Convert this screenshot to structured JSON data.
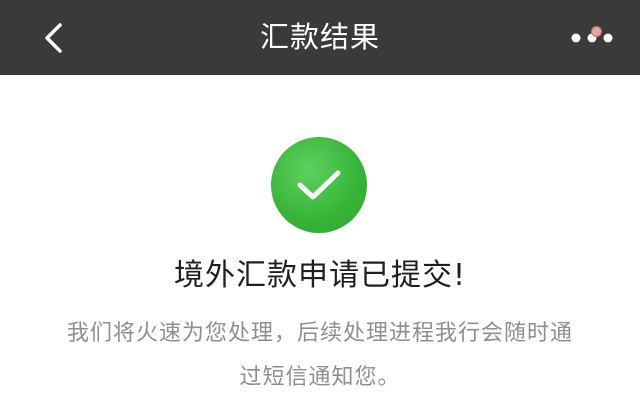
{
  "header": {
    "title": "汇款结果",
    "back_icon": "chevron-left-icon",
    "more_icon": "more-dots-icon",
    "notification_dot_color": "#e7a3a3"
  },
  "result": {
    "status_icon": "check-circle-icon",
    "status_color": "#36b336",
    "title": "境外汇款申请已提交!",
    "description_line1": "我们将火速为您处理，后续处理进程我行会随时通",
    "description_line2": "过短信通知您。"
  }
}
